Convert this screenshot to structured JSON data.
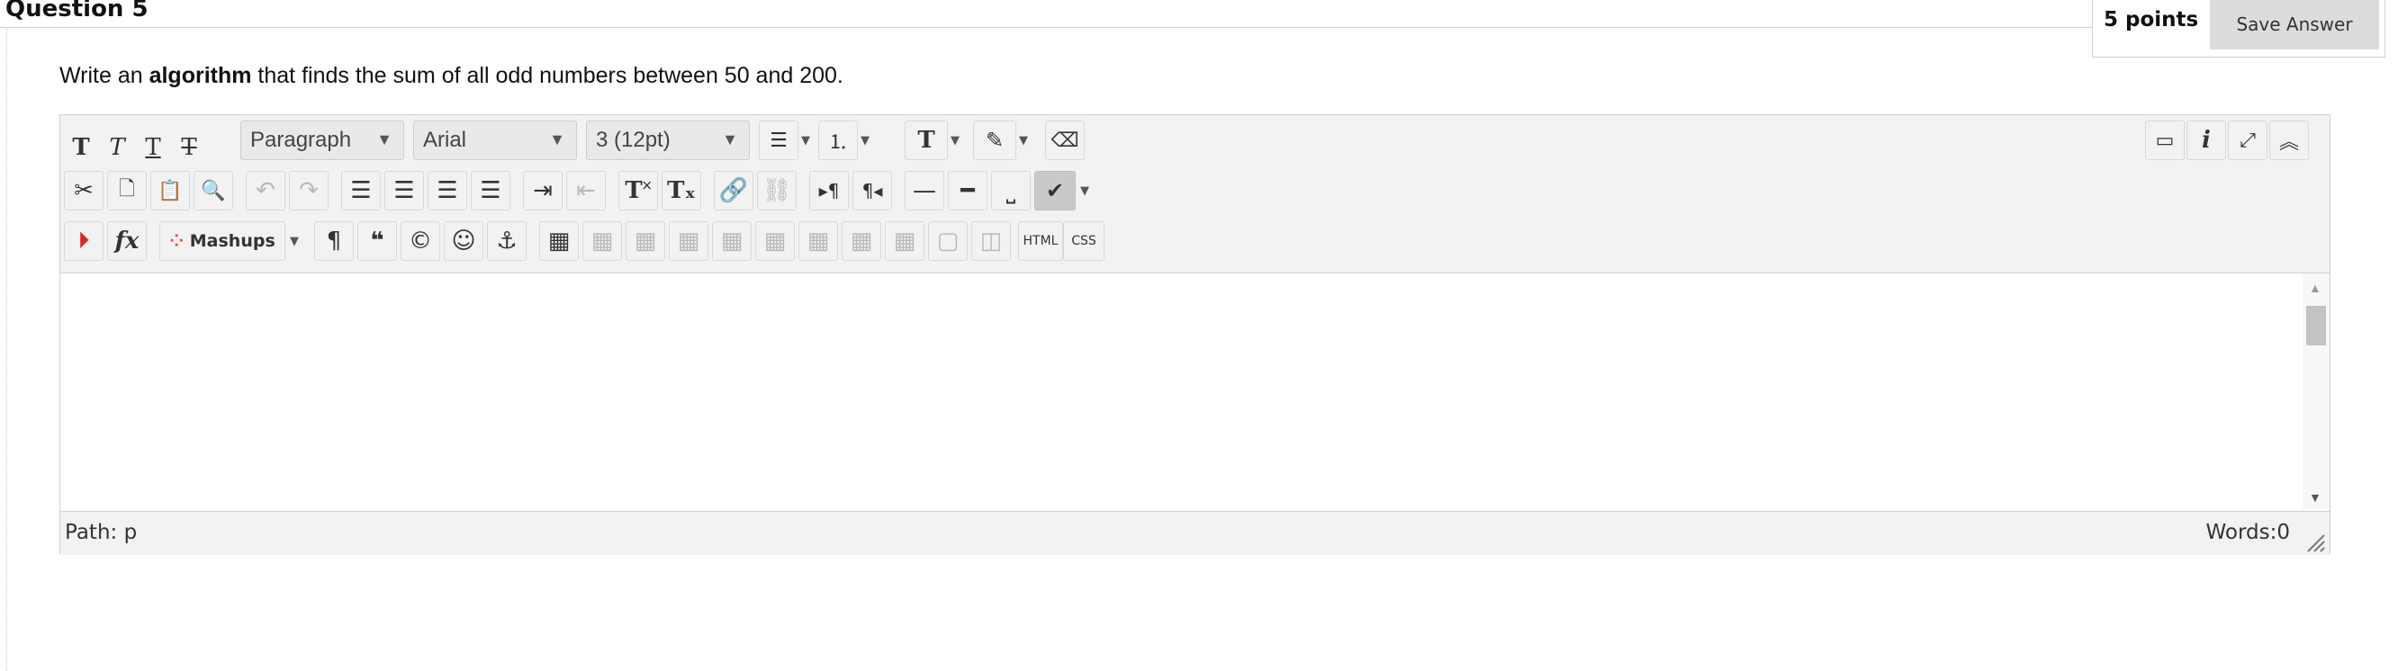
{
  "question": {
    "title": "Question 5",
    "points": "5 points",
    "save_label": "Save Answer",
    "prompt_before": "Write an ",
    "prompt_bold": "algorithm",
    "prompt_after": " that finds the sum of all odd numbers between 50 and 200."
  },
  "editor": {
    "format_select": "Paragraph",
    "font_select": "Arial",
    "size_select": "3 (12pt)",
    "mashups_label": "Mashups",
    "html_label": "HTML",
    "css_label": "CSS",
    "path_label": "Path: p",
    "word_count": "Words:0",
    "content": ""
  }
}
